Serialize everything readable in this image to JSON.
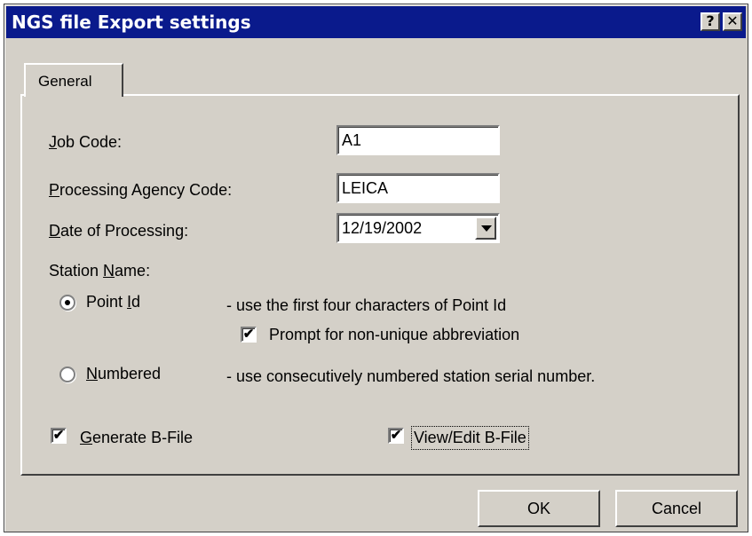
{
  "window": {
    "title": "NGS file Export settings",
    "help_glyph": "?",
    "close_glyph": "✕"
  },
  "tabs": [
    {
      "label": "General"
    }
  ],
  "fields": {
    "job_code": {
      "label_u": "J",
      "label_rest": "ob Code:",
      "value": "A1"
    },
    "agency_code": {
      "label_u": "P",
      "label_rest": "rocessing Agency Code:",
      "value": "LEICA"
    },
    "date": {
      "label_u": "D",
      "label_rest": "ate of Processing:",
      "value": "12/19/2002"
    }
  },
  "station_name": {
    "label_pre": "Station ",
    "label_u": "N",
    "label_rest": "ame:",
    "point_id": {
      "label_pre": "Point ",
      "label_u": "I",
      "label_rest": "d",
      "selected": true,
      "desc": "- use the first four characters of Point Id"
    },
    "prompt": {
      "label": "Prompt for non-unique abbreviation",
      "checked": true
    },
    "numbered": {
      "label_u": "N",
      "label_rest": "umbered",
      "selected": false,
      "desc": "- use consecutively numbered station serial number."
    }
  },
  "bfile": {
    "generate": {
      "label_u": "G",
      "label_rest": "enerate B-File",
      "checked": true
    },
    "view_edit": {
      "label": "View/Edit B-File",
      "checked": true
    }
  },
  "buttons": {
    "ok": "OK",
    "cancel": "Cancel"
  },
  "check_glyph": "✔"
}
